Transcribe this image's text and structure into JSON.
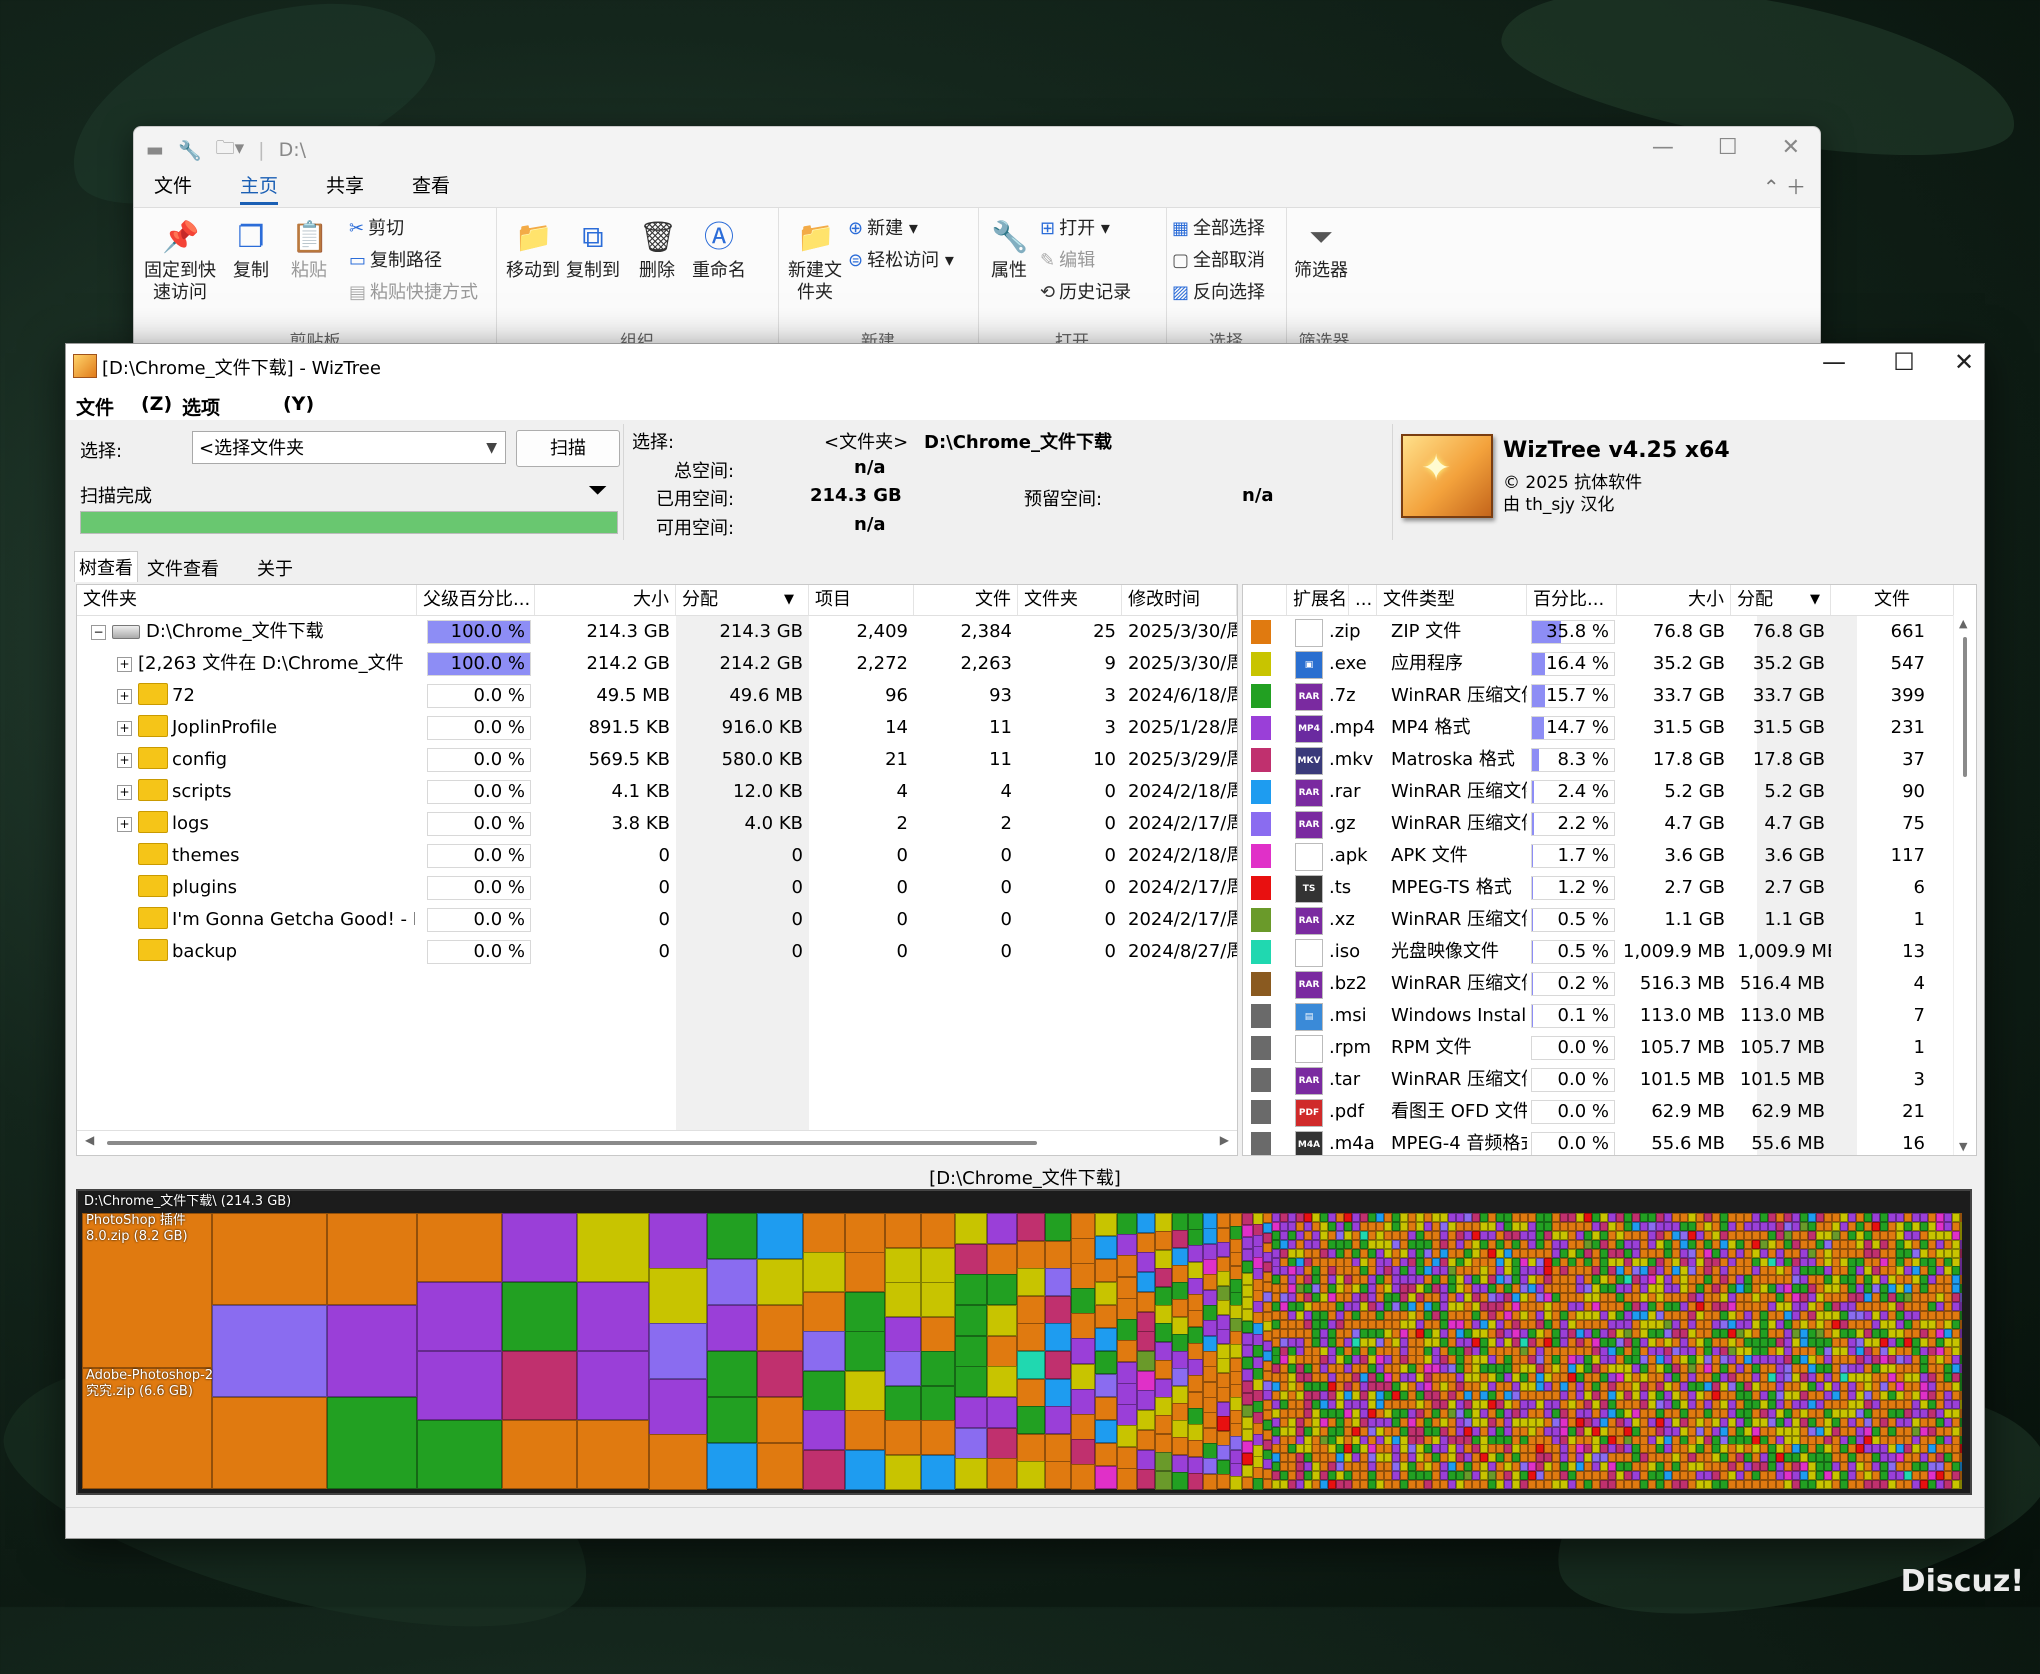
{
  "explorer": {
    "path": "D:\\",
    "tabs": [
      "文件",
      "主页",
      "共享",
      "查看"
    ],
    "active_tab": "主页",
    "groups": [
      {
        "title": "剪贴板",
        "big": [
          "固定到快速访问",
          "复制",
          "粘贴"
        ],
        "small": [
          "剪切",
          "复制路径",
          "粘贴快捷方式"
        ]
      },
      {
        "title": "组织",
        "big": [
          "移动到",
          "复制到",
          "删除",
          "重命名"
        ]
      },
      {
        "title": "新建",
        "big": [
          "新建文件夹"
        ],
        "small": [
          "新建",
          "轻松访问"
        ]
      },
      {
        "title": "打开",
        "big": [
          "属性"
        ],
        "small": [
          "打开",
          "编辑",
          "历史记录"
        ]
      },
      {
        "title": "选择",
        "small": [
          "全部选择",
          "全部取消",
          "反向选择"
        ]
      },
      {
        "title": "筛选器",
        "big": [
          "筛选器"
        ]
      }
    ]
  },
  "wiztree": {
    "title": "[D:\\Chrome_文件下载]  - WizTree",
    "menu": [
      "文件",
      "(Z)",
      "选项",
      "(Y)"
    ],
    "select_label": "选择:",
    "folder_combo": "<选择文件夹",
    "scan_button": "扫描",
    "scan_status": "扫描完成",
    "scan_progress": 1.0,
    "info": {
      "select_label": "选择:",
      "select_type": "<文件夹>",
      "select_path": "D:\\Chrome_文件下载",
      "total_label": "总空间:",
      "total_value": "n/a",
      "used_label": "已用空间:",
      "used_value": "214.3 GB",
      "free_label": "可用空间:",
      "free_value": "n/a",
      "reserved_label": "预留空间:",
      "reserved_value": "n/a"
    },
    "brand": {
      "name": "WizTree v4.25 x64",
      "copyright": "© 2025 抗体软件",
      "translator": "由 th_sjy 汉化"
    },
    "tabs": [
      "树查看",
      "文件查看",
      "关于"
    ],
    "tree": {
      "headers": [
        "文件夹",
        "父级百分比...",
        "大小",
        "分配",
        "项目",
        "文件",
        "文件夹",
        "修改时间"
      ],
      "rows": [
        {
          "name": "D:\\Chrome_文件下载",
          "pct": "100.0 %",
          "pct_value": 100,
          "size": "214.3 GB",
          "alloc": "214.3 GB",
          "items": "2,409",
          "files": "2,384",
          "folders": "25",
          "mtime": "2025/3/30/周",
          "type": "drive",
          "indent": 0,
          "expander": "−"
        },
        {
          "name": "[2,263 文件在      D:\\Chrome_文件",
          "pct": "100.0 %",
          "pct_value": 100,
          "size": "214.2 GB",
          "alloc": "214.2 GB",
          "items": "2,272",
          "files": "2,263",
          "folders": "9",
          "mtime": "2025/3/30/周",
          "type": "files",
          "indent": 1,
          "expander": "+"
        },
        {
          "name": "72",
          "pct": "0.0 %",
          "pct_value": 0,
          "size": "49.5 MB",
          "alloc": "49.6 MB",
          "items": "96",
          "files": "93",
          "folders": "3",
          "mtime": "2024/6/18/周",
          "type": "folder",
          "indent": 1,
          "expander": "+"
        },
        {
          "name": "JoplinProfile",
          "pct": "0.0 %",
          "pct_value": 0,
          "size": "891.5 KB",
          "alloc": "916.0 KB",
          "items": "14",
          "files": "11",
          "folders": "3",
          "mtime": "2025/1/28/周",
          "type": "folder",
          "indent": 1,
          "expander": "+"
        },
        {
          "name": "config",
          "pct": "0.0 %",
          "pct_value": 0,
          "size": "569.5 KB",
          "alloc": "580.0 KB",
          "items": "21",
          "files": "11",
          "folders": "10",
          "mtime": "2025/3/29/周",
          "type": "folder",
          "indent": 1,
          "expander": "+"
        },
        {
          "name": "scripts",
          "pct": "0.0 %",
          "pct_value": 0,
          "size": "4.1 KB",
          "alloc": "12.0 KB",
          "items": "4",
          "files": "4",
          "folders": "0",
          "mtime": "2024/2/18/周",
          "type": "folder",
          "indent": 1,
          "expander": "+"
        },
        {
          "name": "logs",
          "pct": "0.0 %",
          "pct_value": 0,
          "size": "3.8 KB",
          "alloc": "4.0 KB",
          "items": "2",
          "files": "2",
          "folders": "0",
          "mtime": "2024/2/17/周",
          "type": "folder",
          "indent": 1,
          "expander": "+"
        },
        {
          "name": "themes",
          "pct": "0.0 %",
          "pct_value": 0,
          "size": "0",
          "alloc": "0",
          "items": "0",
          "files": "0",
          "folders": "0",
          "mtime": "2024/2/18/周",
          "type": "folder",
          "indent": 1,
          "expander": ""
        },
        {
          "name": "plugins",
          "pct": "0.0 %",
          "pct_value": 0,
          "size": "0",
          "alloc": "0",
          "items": "0",
          "files": "0",
          "folders": "0",
          "mtime": "2024/2/17/周",
          "type": "folder",
          "indent": 1,
          "expander": ""
        },
        {
          "name": "I'm Gonna Getcha Good! - Re",
          "pct": "0.0 %",
          "pct_value": 0,
          "size": "0",
          "alloc": "0",
          "items": "0",
          "files": "0",
          "folders": "0",
          "mtime": "2024/2/17/周",
          "type": "folder",
          "indent": 1,
          "expander": ""
        },
        {
          "name": "backup",
          "pct": "0.0 %",
          "pct_value": 0,
          "size": "0",
          "alloc": "0",
          "items": "0",
          "files": "0",
          "folders": "0",
          "mtime": "2024/8/27/周",
          "type": "folder",
          "indent": 1,
          "expander": ""
        }
      ]
    },
    "ext": {
      "headers": [
        "扩展名",
        "...",
        "文件类型",
        "百分比...",
        "大小",
        "分配",
        "文件"
      ],
      "rows": [
        {
          "color": "#e07a10",
          "ext": ".zip",
          "type": "ZIP 文件",
          "pct": "35.8 %",
          "pct_value": 35.8,
          "size": "76.8 GB",
          "alloc": "76.8 GB",
          "files": "661",
          "icon": "doc"
        },
        {
          "color": "#c8c400",
          "ext": ".exe",
          "type": "应用程序",
          "pct": "16.4 %",
          "pct_value": 16.4,
          "size": "35.2 GB",
          "alloc": "35.2 GB",
          "files": "547",
          "icon": "exe"
        },
        {
          "color": "#22a022",
          "ext": ".7z",
          "type": "WinRAR 压缩文件",
          "pct": "15.7 %",
          "pct_value": 15.7,
          "size": "33.7 GB",
          "alloc": "33.7 GB",
          "files": "399",
          "icon": "rar"
        },
        {
          "color": "#9a3fd8",
          "ext": ".mp4",
          "type": "MP4 格式",
          "pct": "14.7 %",
          "pct_value": 14.7,
          "size": "31.5 GB",
          "alloc": "31.5 GB",
          "files": "231",
          "icon": "mp4"
        },
        {
          "color": "#c0306e",
          "ext": ".mkv",
          "type": "Matroska 格式",
          "pct": "8.3 %",
          "pct_value": 8.3,
          "size": "17.8 GB",
          "alloc": "17.8 GB",
          "files": "37",
          "icon": "mkv"
        },
        {
          "color": "#1e9cf0",
          "ext": ".rar",
          "type": "WinRAR 压缩文件",
          "pct": "2.4 %",
          "pct_value": 2.4,
          "size": "5.2 GB",
          "alloc": "5.2 GB",
          "files": "90",
          "icon": "rar"
        },
        {
          "color": "#8a6cf0",
          "ext": ".gz",
          "type": "WinRAR 压缩文件",
          "pct": "2.2 %",
          "pct_value": 2.2,
          "size": "4.7 GB",
          "alloc": "4.7 GB",
          "files": "75",
          "icon": "rar"
        },
        {
          "color": "#e030c8",
          "ext": ".apk",
          "type": "APK 文件",
          "pct": "1.7 %",
          "pct_value": 1.7,
          "size": "3.6 GB",
          "alloc": "3.6 GB",
          "files": "117",
          "icon": "doc"
        },
        {
          "color": "#e81010",
          "ext": ".ts",
          "type": "MPEG-TS 格式",
          "pct": "1.2 %",
          "pct_value": 1.2,
          "size": "2.7 GB",
          "alloc": "2.7 GB",
          "files": "6",
          "icon": "ts"
        },
        {
          "color": "#6a9a2a",
          "ext": ".xz",
          "type": "WinRAR 压缩文件",
          "pct": "0.5 %",
          "pct_value": 0.5,
          "size": "1.1 GB",
          "alloc": "1.1 GB",
          "files": "1",
          "icon": "rar"
        },
        {
          "color": "#20d8b0",
          "ext": ".iso",
          "type": "光盘映像文件",
          "pct": "0.5 %",
          "pct_value": 0.5,
          "size": "1,009.9 MB",
          "alloc": "1,009.9 MB",
          "files": "13",
          "icon": "doc"
        },
        {
          "color": "#8a5a20",
          "ext": ".bz2",
          "type": "WinRAR 压缩文件",
          "pct": "0.2 %",
          "pct_value": 0.2,
          "size": "516.3 MB",
          "alloc": "516.4 MB",
          "files": "4",
          "icon": "rar"
        },
        {
          "color": "#6a6a6a",
          "ext": ".msi",
          "type": "Windows Installer",
          "pct": "0.1 %",
          "pct_value": 0.1,
          "size": "113.0 MB",
          "alloc": "113.0 MB",
          "files": "7",
          "icon": "msi"
        },
        {
          "color": "#6a6a6a",
          "ext": ".rpm",
          "type": "RPM 文件",
          "pct": "0.0 %",
          "pct_value": 0,
          "size": "105.7 MB",
          "alloc": "105.7 MB",
          "files": "1",
          "icon": "doc"
        },
        {
          "color": "#6a6a6a",
          "ext": ".tar",
          "type": "WinRAR 压缩文件",
          "pct": "0.0 %",
          "pct_value": 0,
          "size": "101.5 MB",
          "alloc": "101.5 MB",
          "files": "3",
          "icon": "rar"
        },
        {
          "color": "#6a6a6a",
          "ext": ".pdf",
          "type": "看图王 OFD 文件",
          "pct": "0.0 %",
          "pct_value": 0,
          "size": "62.9 MB",
          "alloc": "62.9 MB",
          "files": "21",
          "icon": "pdf"
        },
        {
          "color": "#6a6a6a",
          "ext": ".m4a",
          "type": "MPEG-4 音频格式",
          "pct": "0.0 %",
          "pct_value": 0,
          "size": "55.6 MB",
          "alloc": "55.6 MB",
          "files": "16",
          "icon": "m4a"
        }
      ]
    },
    "treemap": {
      "caption": "[D:\\Chrome_文件下载]",
      "root_label": "D:\\Chrome_文件下载\\ (214.3 GB)",
      "labels": [
        {
          "line1": "PhotoShop 插件",
          "line2": "8.0.zip (8.2 GB)"
        },
        {
          "line1": "Adobe-Photoshop-2",
          "line2": "究究.zip (6.6 GB)"
        }
      ]
    }
  },
  "watermark": "Discuz!"
}
